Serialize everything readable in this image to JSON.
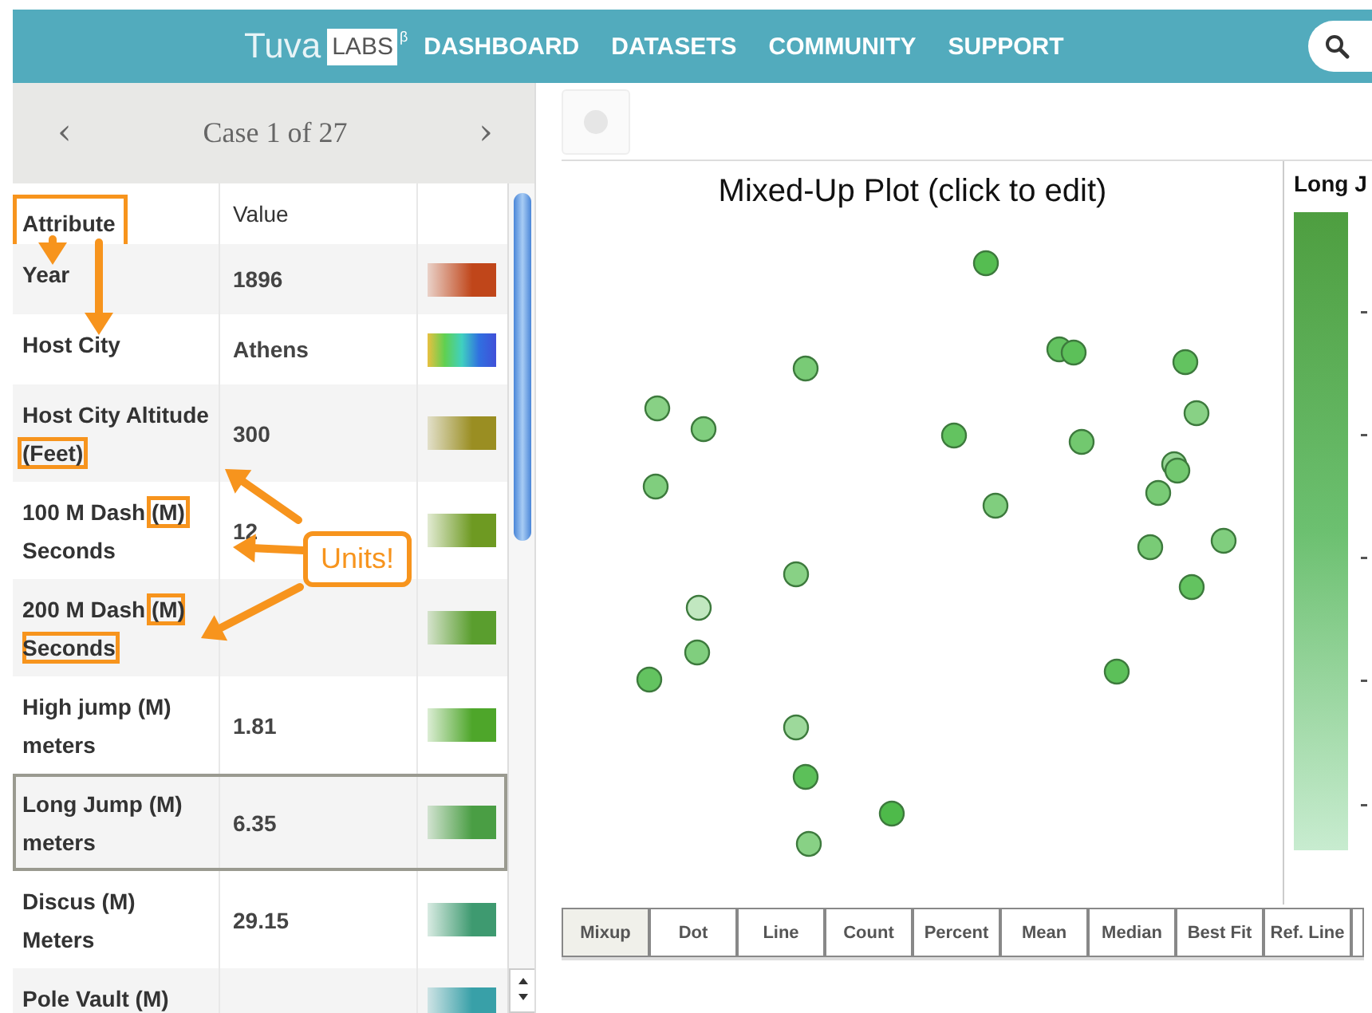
{
  "header": {
    "logo_word": "Tuva",
    "logo_box": "LABS",
    "logo_mark": "β",
    "nav": [
      {
        "label": "DASHBOARD"
      },
      {
        "label": "DATASETS"
      },
      {
        "label": "COMMUNITY"
      },
      {
        "label": "SUPPORT"
      }
    ]
  },
  "case_nav": {
    "prev": "‹",
    "label": "Case  1 of 27",
    "next": "›"
  },
  "table": {
    "columns": [
      {
        "label": "Attribute",
        "highlighted": true
      },
      {
        "label": "Value",
        "highlighted": false
      }
    ],
    "rows": [
      {
        "name": [
          {
            "text": "Year",
            "highlighted": false
          }
        ],
        "value": "1896",
        "kind": "gradient",
        "color": "#c0461a",
        "selected": false
      },
      {
        "name": [
          {
            "text": "Host City",
            "highlighted": false
          }
        ],
        "value": "Athens",
        "kind": "rainbow",
        "selected": false
      },
      {
        "name": [
          {
            "text": "Host City Altitude ",
            "highlighted": false
          },
          {
            "text": "(Feet)",
            "highlighted": true
          }
        ],
        "value": "300",
        "kind": "gradient",
        "color": "#9a8e22",
        "selected": false
      },
      {
        "name": [
          {
            "text": "100 M Dash ",
            "highlighted": false
          },
          {
            "text": "(M)",
            "highlighted": true
          },
          {
            "text": " Seconds",
            "highlighted": false
          }
        ],
        "value": "12",
        "kind": "gradient",
        "color": "#6e9a22",
        "selected": false
      },
      {
        "name": [
          {
            "text": "200 M Dash ",
            "highlighted": false
          },
          {
            "text": "(M) Seconds",
            "highlighted": true
          }
        ],
        "kind": "gradient",
        "color": "#5a9e2e",
        "selected": false
      },
      {
        "name": [
          {
            "text": "High jump (M) meters",
            "highlighted": false
          }
        ],
        "value": "1.81",
        "kind": "gradient",
        "color": "#4ea62a",
        "selected": false
      },
      {
        "name": [
          {
            "text": "Long Jump (M) meters",
            "highlighted": false
          }
        ],
        "value": "6.35",
        "kind": "gradient",
        "color": "#4a9e44",
        "selected": true
      },
      {
        "name": [
          {
            "text": "Discus (M) Meters",
            "highlighted": false
          }
        ],
        "value": "29.15",
        "kind": "gradient",
        "color": "#3e9a70",
        "selected": false
      },
      {
        "name": [
          {
            "text": "Pole Vault (M)",
            "highlighted": false
          }
        ],
        "kind": "gradient",
        "color": "#38a0a8",
        "selected": false
      }
    ]
  },
  "callout": {
    "text": "Units!"
  },
  "plot": {
    "title": "Mixed-Up Plot (click to edit)",
    "legend_title": "Long J"
  },
  "plot_types": [
    {
      "label": "Mixup",
      "selected": true
    },
    {
      "label": "Dot",
      "selected": false
    },
    {
      "label": "Line",
      "selected": false
    },
    {
      "label": "Count",
      "selected": false
    },
    {
      "label": "Percent",
      "selected": false
    },
    {
      "label": "Mean",
      "selected": false
    },
    {
      "label": "Median",
      "selected": false
    },
    {
      "label": "Best Fit",
      "selected": false
    },
    {
      "label": "Ref. Line",
      "selected": false
    }
  ]
}
